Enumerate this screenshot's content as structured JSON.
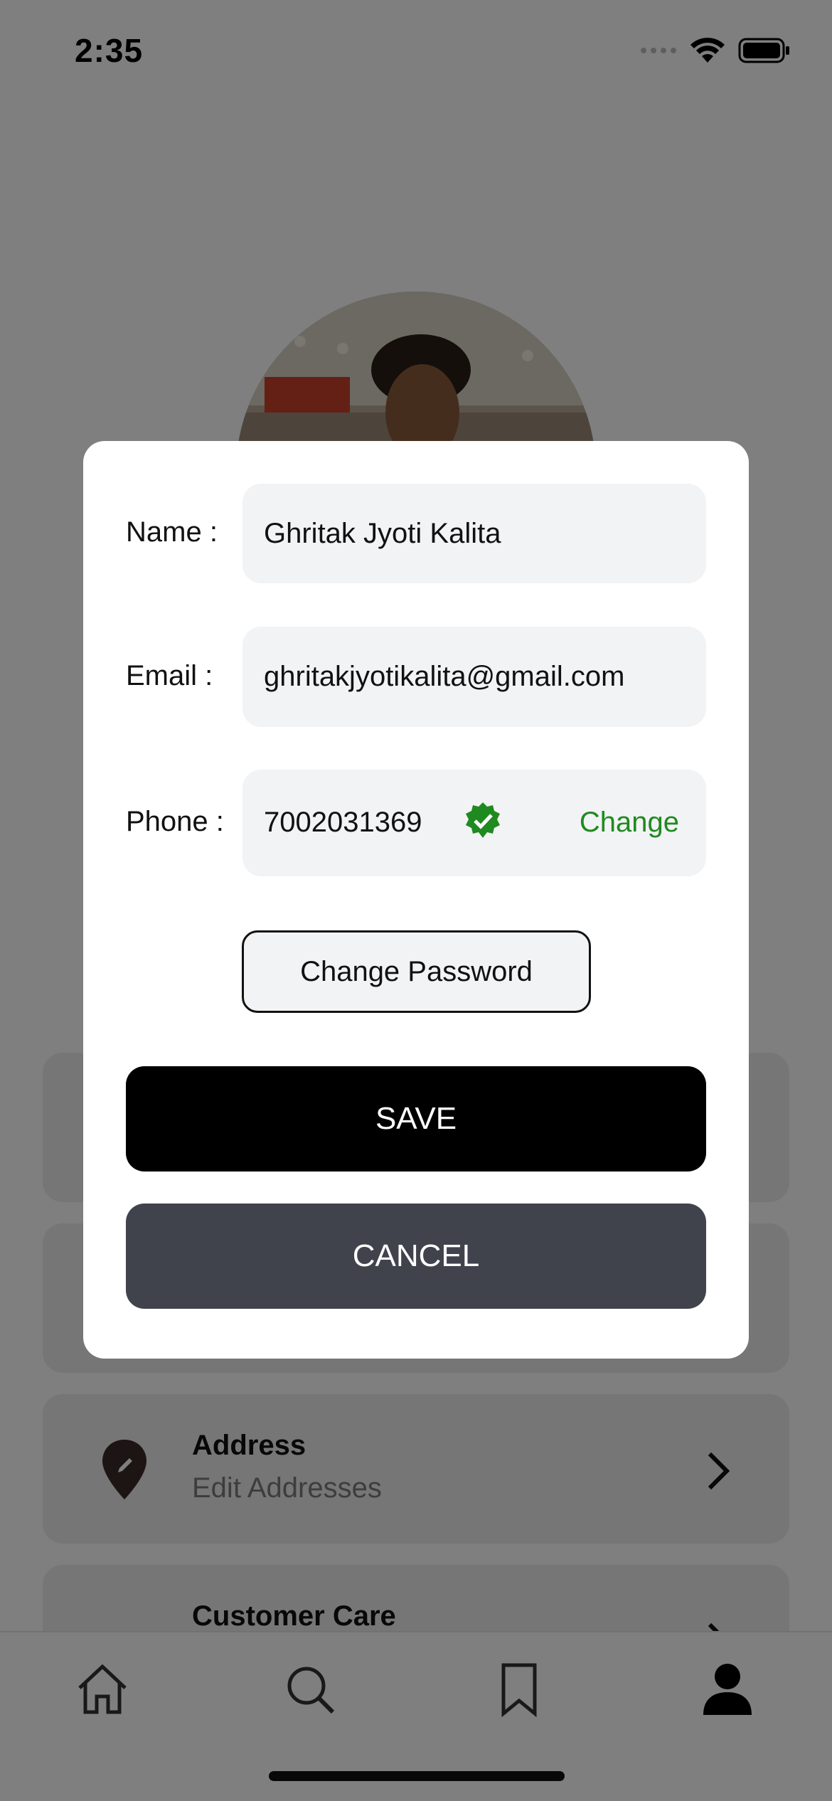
{
  "status_bar": {
    "time": "2:35"
  },
  "menu": {
    "address": {
      "title": "Address",
      "subtitle": "Edit Addresses"
    },
    "customer_care": {
      "title": "Customer Care"
    }
  },
  "nav": {
    "items": [
      {
        "icon": "home-icon"
      },
      {
        "icon": "search-icon"
      },
      {
        "icon": "bookmark-icon"
      },
      {
        "icon": "profile-icon",
        "active": true
      }
    ]
  },
  "modal": {
    "name_label": "Name :",
    "name_value": "Ghritak Jyoti Kalita",
    "email_label": "Email :",
    "email_value": "ghritakjyotikalita@gmail.com",
    "phone_label": "Phone :",
    "phone_value": "7002031369",
    "phone_change": "Change",
    "change_password": "Change Password",
    "save": "SAVE",
    "cancel": "CANCEL"
  },
  "colors": {
    "verified": "#1f8a1f",
    "save_bg": "#000000",
    "cancel_bg": "#40434b",
    "field_bg": "#f2f3f5"
  }
}
